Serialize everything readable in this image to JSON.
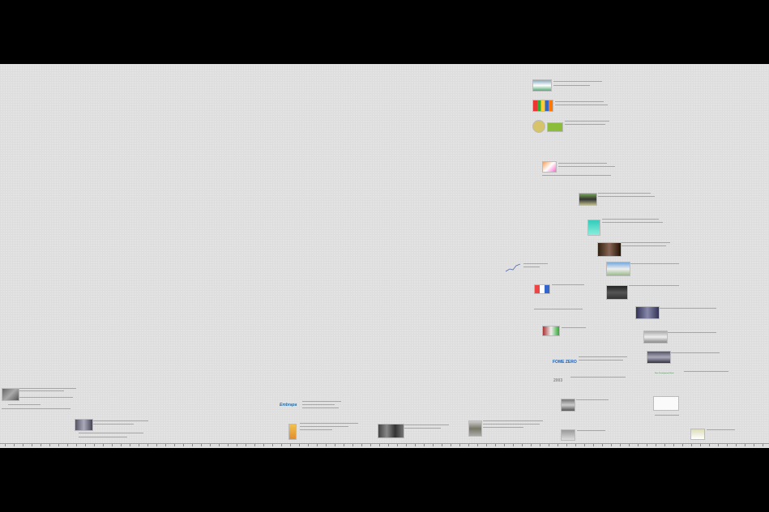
{
  "window": {
    "title": ""
  },
  "timeline": {
    "events": [
      {
        "id": "e1",
        "title": ""
      },
      {
        "id": "e2",
        "title": ""
      },
      {
        "id": "e3",
        "title": ""
      },
      {
        "id": "e4",
        "title": ""
      },
      {
        "id": "e5",
        "title": ""
      },
      {
        "id": "e6",
        "title": ""
      }
    ],
    "logos": {
      "fome_zero": "FOME ZERO",
      "year_2003": "2003",
      "embrapa": "Embrapa",
      "ndb": "New Development Bank"
    }
  },
  "colors": {
    "letterbox": "#000000",
    "canvas": "#e3e3e3",
    "grid": "#d9d9d9",
    "axis": "#9a9a9a"
  }
}
